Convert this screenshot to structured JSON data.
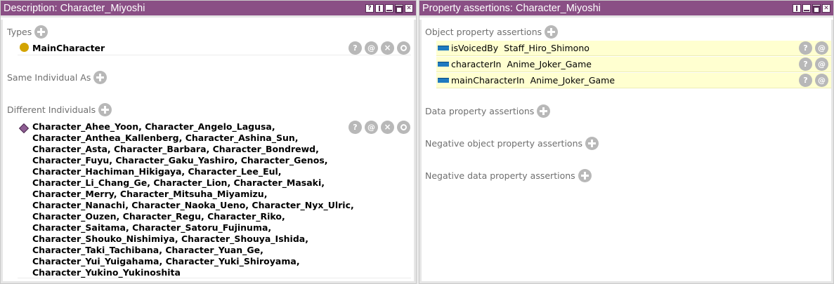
{
  "left": {
    "title": "Description: Character_Miyoshi",
    "window_buttons": [
      "?",
      "split",
      "min",
      "max",
      "close"
    ],
    "types": {
      "header": "Types",
      "items": [
        {
          "label": "MainCharacter"
        }
      ]
    },
    "same_individual": {
      "header": "Same Individual As"
    },
    "different_individuals": {
      "header": "Different Individuals",
      "lines": [
        "Character_Ahee_Yoon, Character_Angelo_Lagusa,",
        "Character_Anthea_Kallenberg, Character_Ashina_Sun,",
        "Character_Asta, Character_Barbara, Character_Bondrewd,",
        "Character_Fuyu, Character_Gaku_Yashiro, Character_Genos,",
        "Character_Hachiman_Hikigaya, Character_Lee_Eul,",
        "Character_Li_Chang_Ge, Character_Lion, Character_Masaki,",
        "Character_Merry, Character_Mitsuha_Miyamizu,",
        "Character_Nanachi, Character_Naoka_Ueno, Character_Nyx_Ulric,",
        "Character_Ouzen, Character_Regu, Character_Riko,",
        "Character_Saitama, Character_Satoru_Fujinuma,",
        "Character_Shouko_Nishimiya, Character_Shouya_Ishida,",
        "Character_Taki_Tachibana, Character_Yuan_Ge,",
        "Character_Yui_Yuigahama, Character_Yuki_Shiroyama,",
        "Character_Yukino_Yukinoshita"
      ]
    },
    "row_buttons": {
      "help": "?",
      "annotate": "@",
      "delete": "×"
    }
  },
  "right": {
    "title": "Property assertions: Character_Miyoshi",
    "object_property_assertions": {
      "header": "Object property assertions",
      "rows": [
        {
          "property": "isVoicedBy",
          "value": "Staff_Hiro_Shimono"
        },
        {
          "property": "characterIn",
          "value": "Anime_Joker_Game"
        },
        {
          "property": "mainCharacterIn",
          "value": "Anime_Joker_Game"
        }
      ]
    },
    "data_property_assertions": {
      "header": "Data property assertions"
    },
    "negative_object_property_assertions": {
      "header": "Negative object property assertions"
    },
    "negative_data_property_assertions": {
      "header": "Negative data property assertions"
    }
  },
  "colors": {
    "titlebar": "#8a4f85",
    "class_icon": "#d3a400",
    "individual_icon": "#8e5d93",
    "object_property_icon": "#1f7ac0",
    "assertion_row_bg": "#ffffd0"
  }
}
